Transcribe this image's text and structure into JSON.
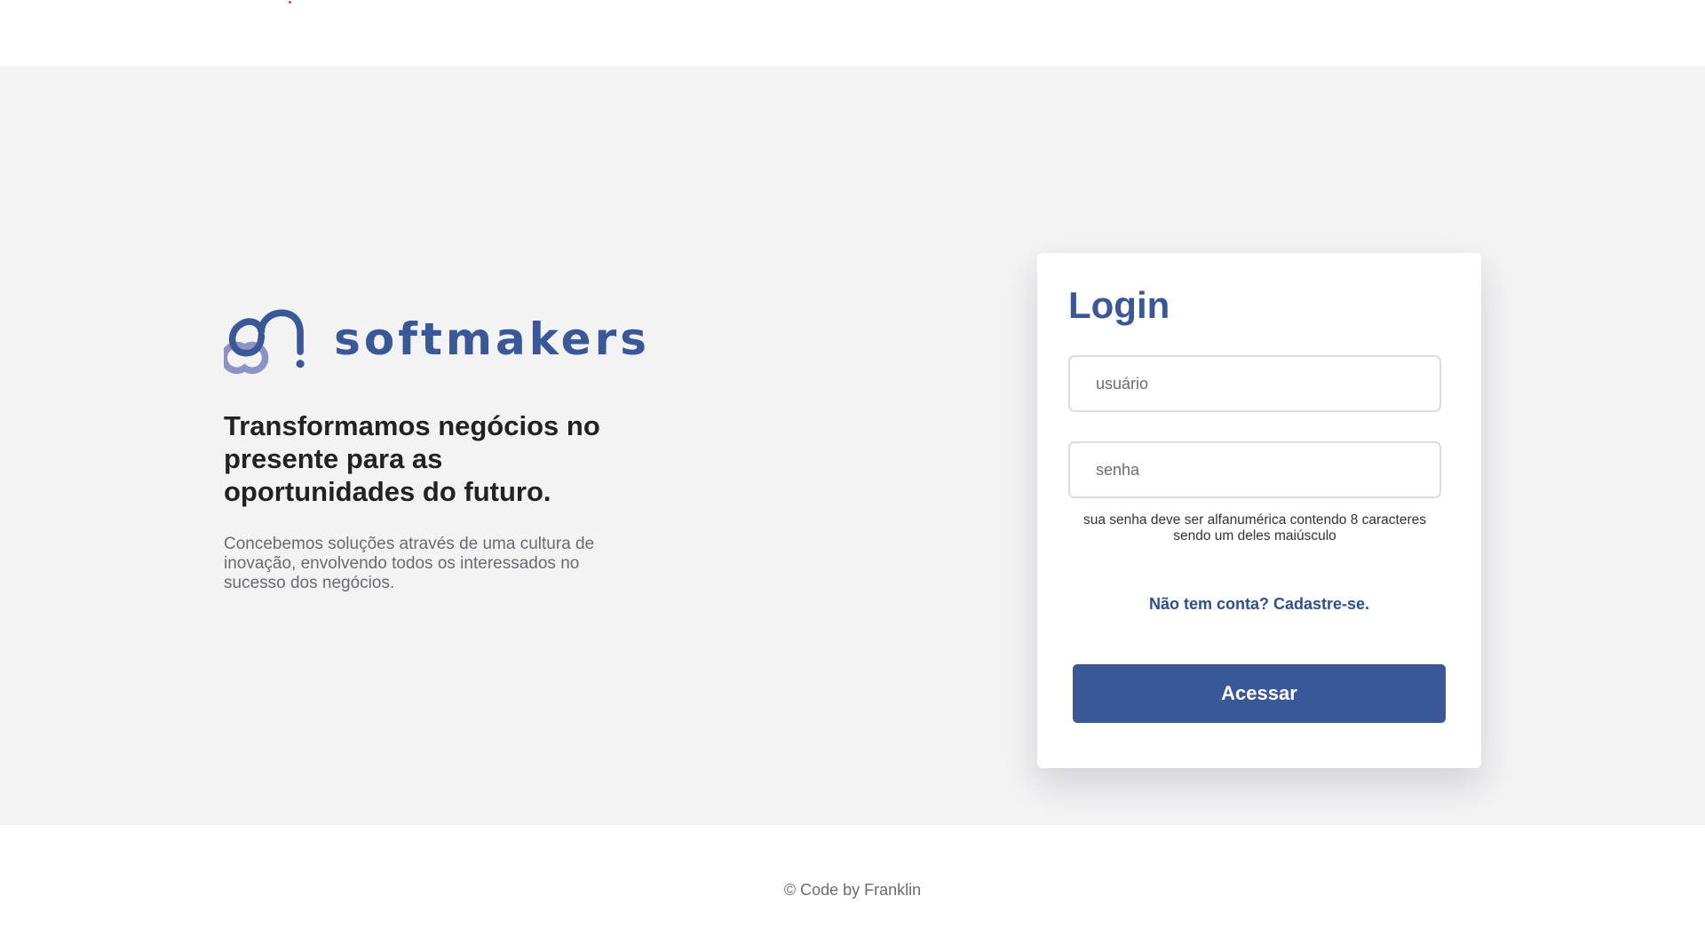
{
  "brand": {
    "logo_text": "softmakers",
    "headline": "Transformamos negócios no presente para as oportunidades do futuro.",
    "description": "Concebemos soluções através de uma cultura de inovação, envolvendo todos os interessados no sucesso dos negócios.",
    "logo_icon": "sm-monogram-icon"
  },
  "login": {
    "title": "Login",
    "username_placeholder": "usuário",
    "password_placeholder": "senha",
    "password_hint": "sua senha deve ser alfanumérica contendo 8 caracteres sendo um deles maiúsculo",
    "signup_link": "Não tem conta? Cadastre-se.",
    "submit_label": "Acessar"
  },
  "footer": {
    "copyright_symbol": "©",
    "credit": "Code by Franklin"
  },
  "colors": {
    "brand_blue": "#3a5898",
    "logo_light": "#8a93c3",
    "background": "#f3f3f4",
    "text_dark": "#222222",
    "text_muted": "#6a6a72"
  }
}
